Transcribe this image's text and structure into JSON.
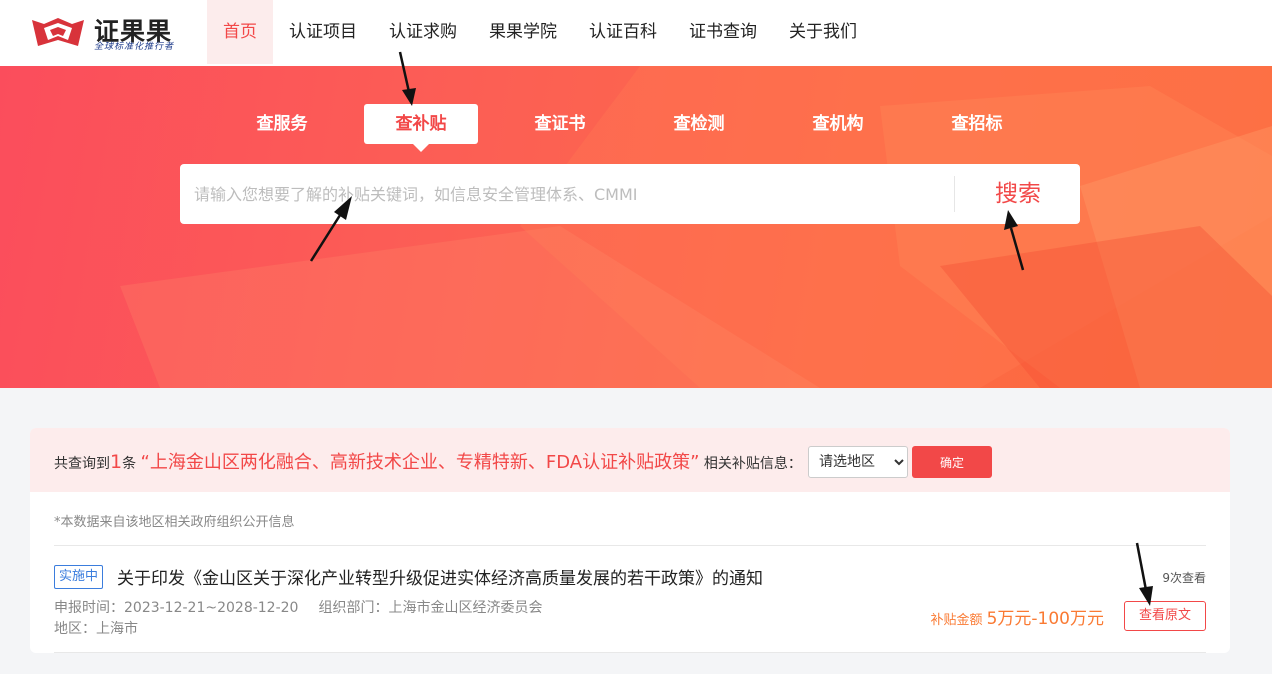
{
  "header": {
    "logo": {
      "title": "证果果",
      "subtitle": "全球标准化推行者"
    },
    "nav": [
      {
        "label": "首页",
        "active": true
      },
      {
        "label": "认证项目"
      },
      {
        "label": "认证求购"
      },
      {
        "label": "果果学院"
      },
      {
        "label": "认证百科"
      },
      {
        "label": "证书查询"
      },
      {
        "label": "关于我们"
      }
    ]
  },
  "hero": {
    "tabs": [
      {
        "label": "查服务"
      },
      {
        "label": "查补贴",
        "active": true
      },
      {
        "label": "查证书"
      },
      {
        "label": "查检测"
      },
      {
        "label": "查机构"
      },
      {
        "label": "查招标"
      }
    ],
    "search": {
      "placeholder": "请输入您想要了解的补贴关键词，如信息安全管理体系、CMMI",
      "value": "",
      "button_label": "搜索"
    }
  },
  "results": {
    "summary": {
      "prefix": "共查询到",
      "count": "1",
      "count_unit": "条",
      "keyword": "“上海金山区两化融合、高新技术企业、专精特新、FDA认证补贴政策”",
      "suffix": "相关补贴信息："
    },
    "region_select": {
      "selected": "请选地区",
      "options": [
        "请选地区"
      ]
    },
    "confirm_label": "确定",
    "notice": "*本数据来自该地区相关政府组织公开信息",
    "items": [
      {
        "status": "实施中",
        "title": "关于印发《金山区关于深化产业转型升级促进实体经济高质量发展的若干政策》的通知",
        "views": "9次查看",
        "period_label": "申报时间：",
        "period": "2023-12-21~2028-12-20",
        "dept_label": "组织部门：",
        "dept": "上海市金山区经济委员会",
        "region_label": "地区：",
        "region": "上海市",
        "amount_label": "补贴金额",
        "amount": "5万元-100万元",
        "view_label": "查看原文"
      }
    ]
  },
  "colors": {
    "brand": "#f24848",
    "hero_start": "#fb4d5c",
    "hero_end": "#fc6a3c",
    "status_blue": "#3b7ddd",
    "amount_orange": "#fa7a33"
  }
}
